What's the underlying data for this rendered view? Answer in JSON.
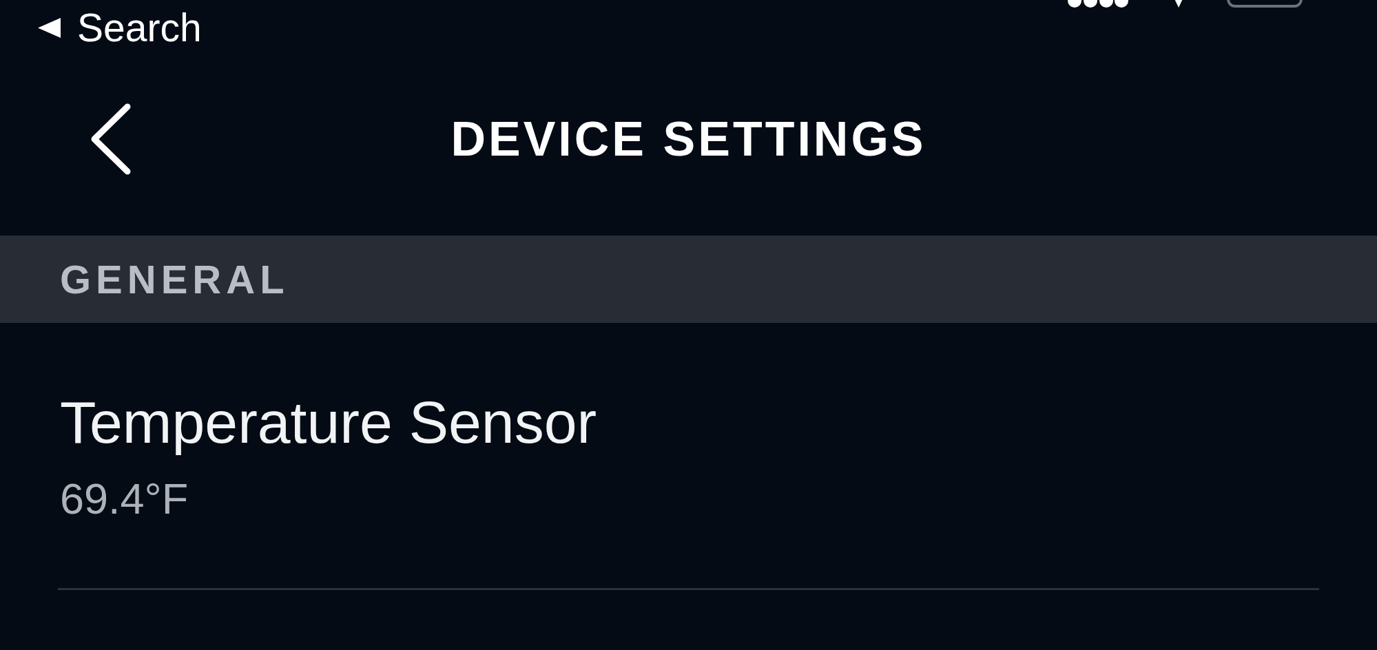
{
  "status_bar": {
    "back_link": {
      "label": "Search"
    }
  },
  "nav_bar": {
    "title": "DEVICE SETTINGS"
  },
  "sections": [
    {
      "header": "GENERAL",
      "rows": [
        {
          "title": "Temperature Sensor",
          "value": "69.4°F"
        }
      ]
    }
  ]
}
